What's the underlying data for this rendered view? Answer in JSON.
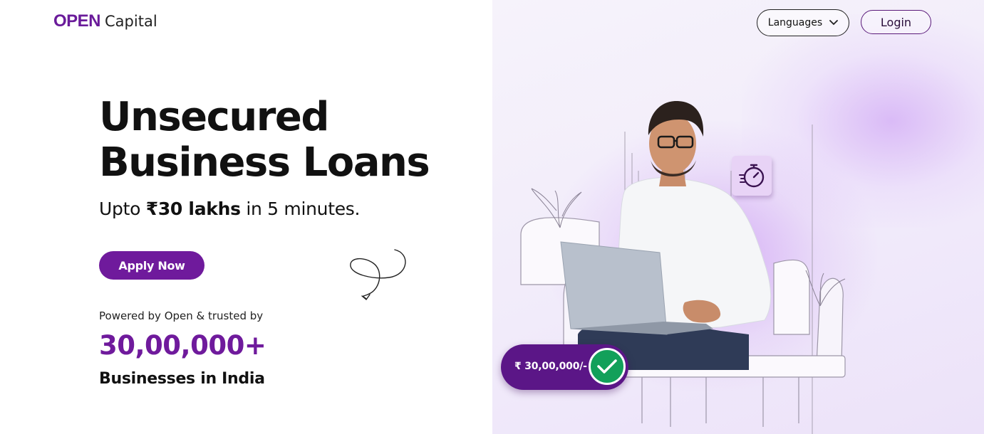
{
  "brand": {
    "logo_open": "OPEN",
    "logo_capital": "Capital",
    "accent": "#6f1a9c"
  },
  "header": {
    "languages_label": "Languages",
    "login_label": "Login"
  },
  "hero": {
    "headline_line1": "Unsecured",
    "headline_line2": "Business Loans",
    "sub_prefix": "Upto",
    "sub_amount": "₹30 lakhs",
    "sub_suffix": "in 5 minutes.",
    "apply_label": "Apply Now"
  },
  "trust": {
    "powered_text": "Powered by Open & trusted by",
    "count": "30,00,000+",
    "businesses_text": "Businesses in India"
  },
  "illustration": {
    "amount_badge": "₹ 30,00,000/-",
    "icons": [
      "timer-icon",
      "check-icon",
      "squiggle-arrow-icon",
      "chevron-down-icon"
    ]
  }
}
